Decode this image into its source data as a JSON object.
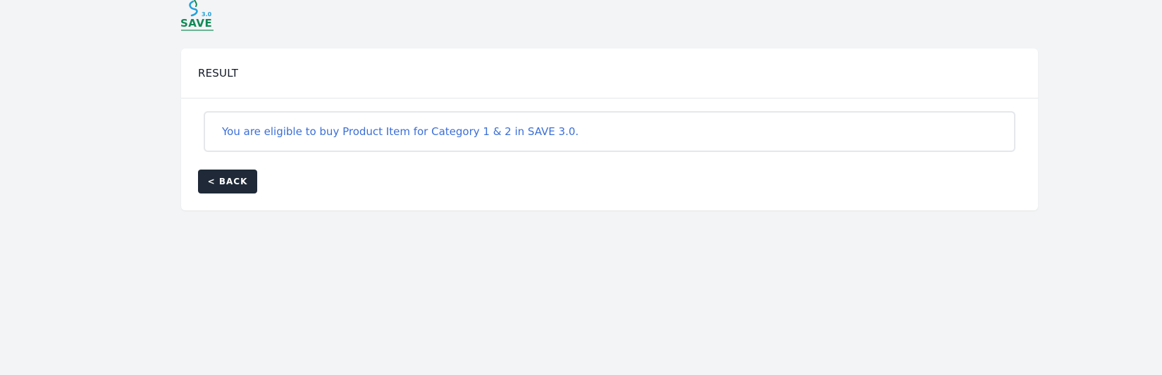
{
  "logo": {
    "name": "SAVE",
    "version": "3.0",
    "colors": {
      "primary": "#0f8a55",
      "accent": "#22a0d8"
    }
  },
  "card": {
    "title": "RESULT",
    "message": "You are eligible to buy Product Item for Category 1 & 2 in SAVE 3.0.",
    "back_label": "< BACK"
  },
  "colors": {
    "background": "#f3f4f6",
    "message_text": "#3b6fd8",
    "button_bg": "#1f2937"
  }
}
